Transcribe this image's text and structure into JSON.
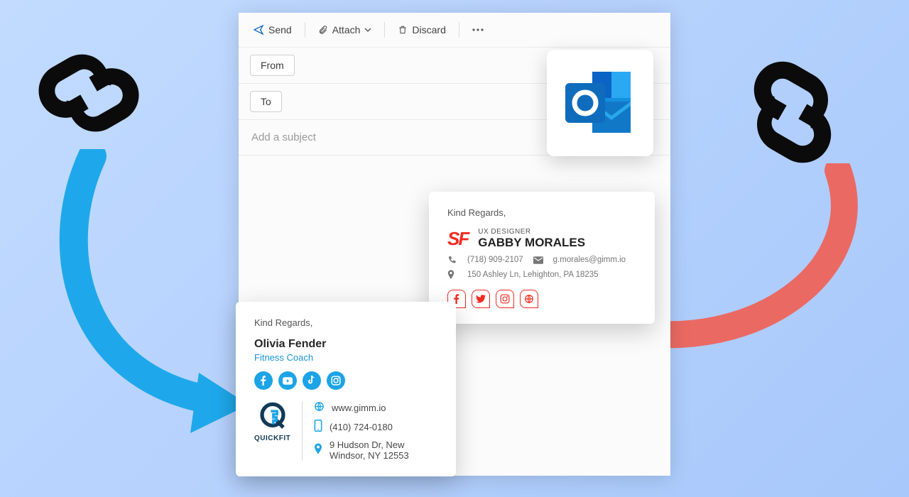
{
  "toolbar": {
    "send": "Send",
    "attach": "Attach",
    "discard": "Discard"
  },
  "fields": {
    "from": "From",
    "to": "To",
    "subject_placeholder": "Add a subject"
  },
  "signature1": {
    "regards": "Kind Regards,",
    "logo": "SF",
    "role": "UX DESIGNER",
    "name": "GABBY MORALES",
    "phone": "(718) 909-2107",
    "email": "g.morales@gimm.io",
    "address": "150 Ashley Ln, Lehighton, PA 18235"
  },
  "signature2": {
    "regards": "Kind Regards,",
    "name": "Olivia Fender",
    "title": "Fitness Coach",
    "brand": "QUICKFIT",
    "website": "www.gimm.io",
    "phone": "(410) 724-0180",
    "address": "9 Hudson Dr, New Windsor, NY 12553"
  }
}
